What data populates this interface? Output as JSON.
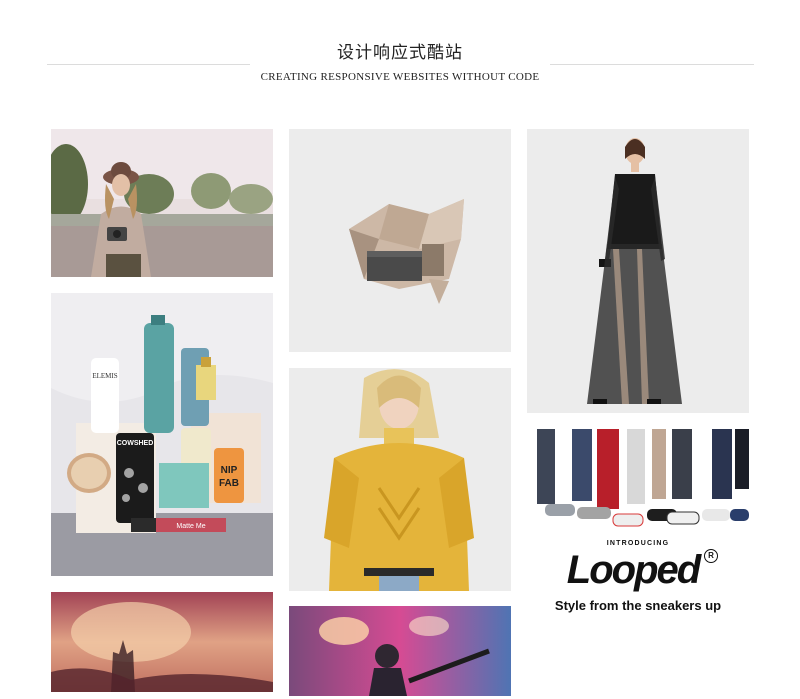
{
  "header": {
    "title": "设计响应式酷站",
    "subtitle": "CREATING RESPONSIVE WEBSITES WITHOUT CODE"
  },
  "gallery": {
    "items": [
      {
        "name": "woman-with-camera-photo",
        "icon": "photo"
      },
      {
        "name": "skincare-products-photo",
        "icon": "photo"
      },
      {
        "name": "concert-crowd-photo",
        "icon": "photo"
      },
      {
        "name": "crumpled-paper-package-photo",
        "icon": "photo"
      },
      {
        "name": "yellow-ruffle-sweater-photo",
        "icon": "photo"
      },
      {
        "name": "guitarist-stage-photo",
        "icon": "photo"
      },
      {
        "name": "black-sheer-dress-photo",
        "icon": "photo"
      },
      {
        "name": "sneakers-ad-banner",
        "icon": "photo"
      }
    ],
    "ad": {
      "intro": "INTRODUCING",
      "brand": "Looped",
      "registered": "R",
      "tagline": "Style from the sneakers up"
    }
  },
  "colors": {
    "background": "#ffffff",
    "rule": "#dcdcdc",
    "text": "#222222"
  }
}
